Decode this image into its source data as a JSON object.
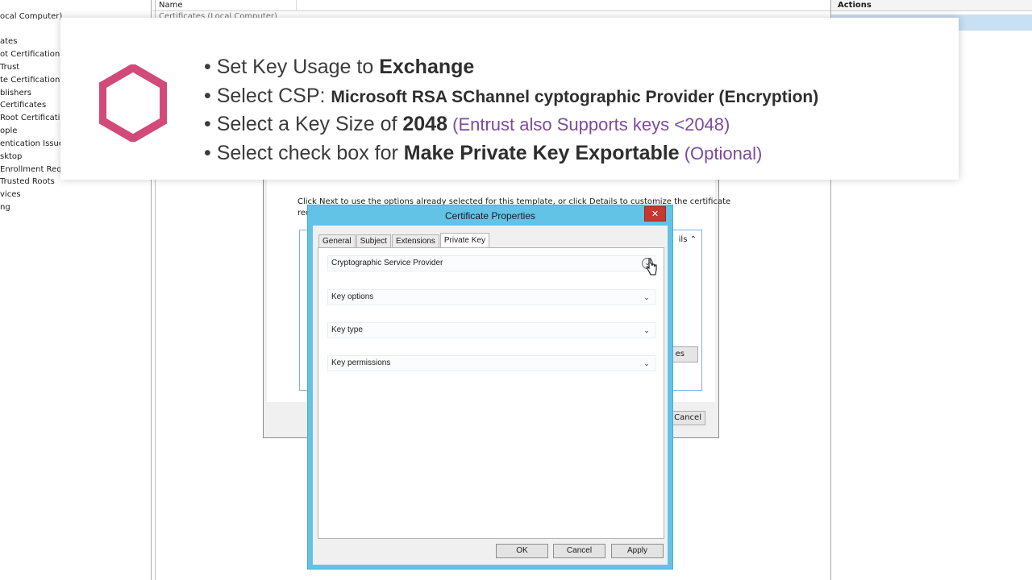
{
  "tree": {
    "items": [
      "ocal Computer)",
      "ates",
      "ot Certification A",
      "Trust",
      "te Certification A",
      "blishers",
      "Certificates",
      "Root Certificati",
      "ople",
      "entication Issue",
      "sktop",
      "Enrollment Requ",
      "Trusted Roots",
      "vices",
      "ng"
    ]
  },
  "center": {
    "name_header": "Name",
    "ghost_row": "Certificates (Local Computer)"
  },
  "actions": {
    "header": "Actions"
  },
  "wizard": {
    "text_line1": "Click Next to use the options already selected for this template, or click Details to customize the certificate",
    "text_line2": "req",
    "details": "ils",
    "properties_btn": "es",
    "cancel_btn": "Cancel"
  },
  "banner": {
    "brand_color": "#d14a7a",
    "bullet1": {
      "prefix": "• Set Key Usage to ",
      "bold": "Exchange"
    },
    "bullet2": {
      "prefix": "• Select CSP: ",
      "bold": "Microsoft RSA SChannel cyptographic Provider (Encryption)"
    },
    "bullet3": {
      "prefix": "• Select a Key Size of ",
      "bold": "2048",
      "note": " (Entrust also Supports keys <2048)"
    },
    "bullet4": {
      "prefix": "• Select check box for ",
      "bold": "Make Private Key Exportable",
      "note": " (Optional)"
    }
  },
  "dialog": {
    "title": "Certificate Properties",
    "close_label": "✕",
    "tabs": [
      "General",
      "Subject",
      "Extensions",
      "Private Key"
    ],
    "sections": [
      {
        "label": "Cryptographic Service Provider",
        "icon": "chevron-down-circle-icon"
      },
      {
        "label": "Key options",
        "icon": "chevron-down-icon"
      },
      {
        "label": "Key type",
        "icon": "chevron-down-icon"
      },
      {
        "label": "Key permissions",
        "icon": "chevron-down-icon"
      }
    ],
    "buttons": {
      "ok": "OK",
      "cancel": "Cancel",
      "apply": "Apply"
    }
  }
}
